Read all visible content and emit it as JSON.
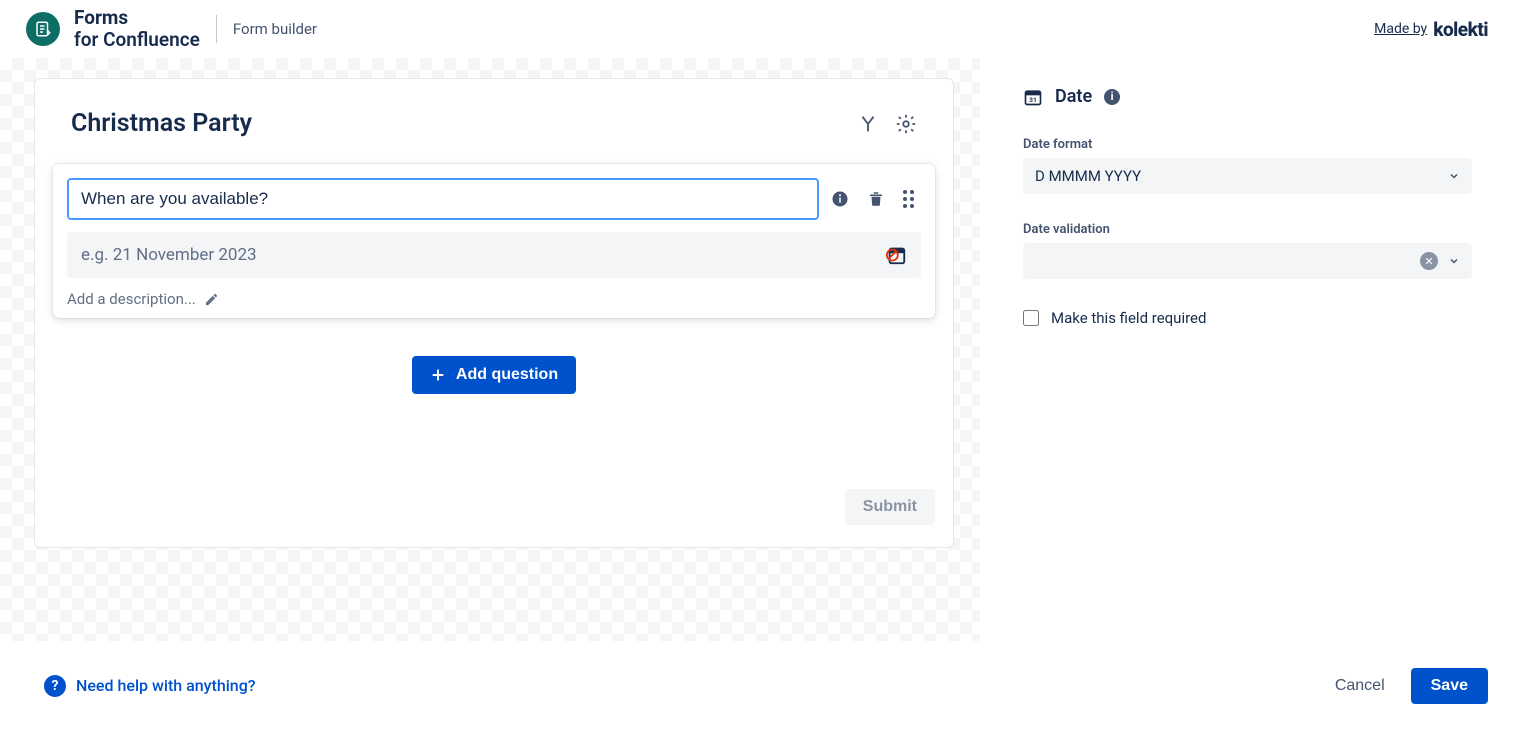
{
  "header": {
    "app_line1": "Forms",
    "app_line2": "for Confluence",
    "breadcrumb": "Form builder",
    "madeby": "Made by",
    "brand": "kolekti"
  },
  "form": {
    "title": "Christmas Party",
    "question_value": "When are you available?",
    "date_placeholder": "e.g. 21 November 2023",
    "description_prompt": "Add a description...",
    "add_question": "Add question",
    "submit": "Submit"
  },
  "side": {
    "title": "Date",
    "format_label": "Date format",
    "format_value": "D MMMM YYYY",
    "validation_label": "Date validation",
    "required_label": "Make this field required"
  },
  "footer": {
    "help": "Need help with anything?",
    "cancel": "Cancel",
    "save": "Save"
  }
}
